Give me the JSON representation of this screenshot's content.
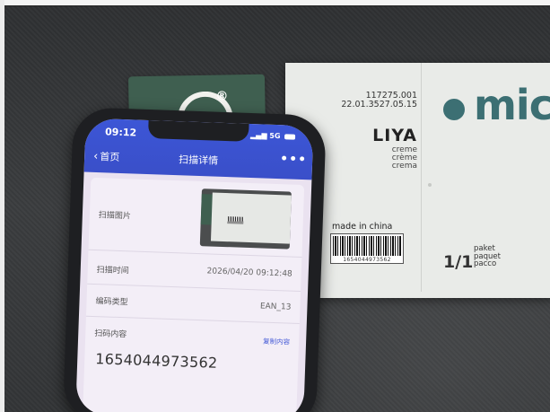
{
  "label_card": {
    "code_line1": "117275.001",
    "code_line2": "22.01.3527.05.15",
    "product_name": "LIYA",
    "color_1": "creme",
    "color_2": "crème",
    "color_3": "crema",
    "origin": "made in china",
    "barcode_number": "1654044973562",
    "brand": "mic",
    "pack_count": "1/1",
    "unit_1": "paket",
    "unit_2": "paquet",
    "unit_3": "pacco",
    "brand_color": "#3c6f73"
  },
  "tag": {
    "mark": "®",
    "color": "#3f5f50"
  },
  "phone": {
    "status": {
      "time": "09:12",
      "network": "5G"
    },
    "nav": {
      "back_label": "首页",
      "title": "扫描详情",
      "more": "•••",
      "bar_color": "#3c56d6"
    },
    "details": {
      "image_label": "扫描图片",
      "time_label": "扫描时间",
      "time_value": "2026/04/20 09:12:48",
      "type_label": "编码类型",
      "type_value": "EAN_13",
      "content_label": "扫码内容",
      "copy_label": "复制内容",
      "content_value": "1654044973562"
    }
  }
}
